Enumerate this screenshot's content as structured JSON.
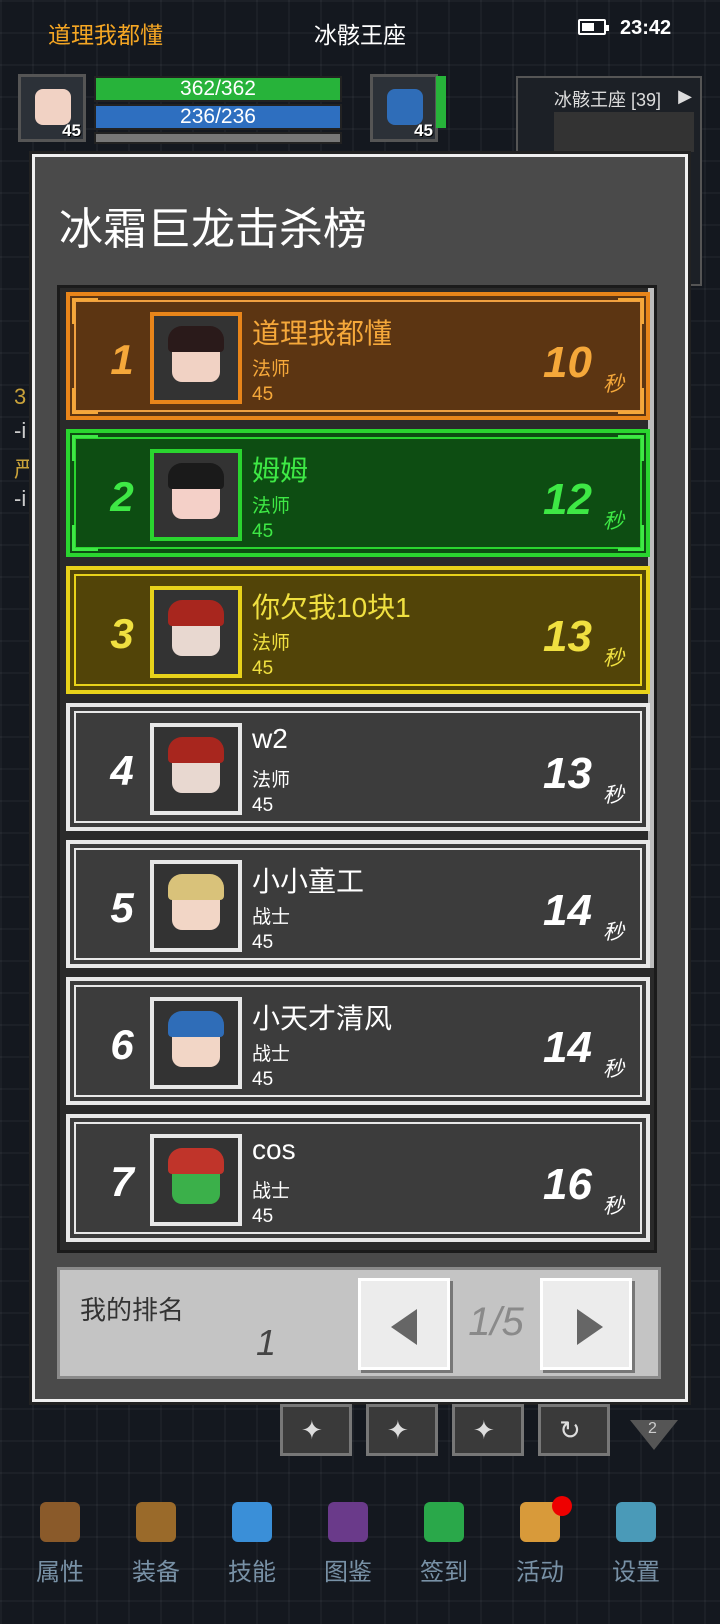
{
  "status_bar": {
    "player_name": "道理我都懂",
    "location": "冰骸王座",
    "time": "23:42"
  },
  "hud": {
    "player_level": "45",
    "hp": "362/362",
    "mp": "236/236",
    "pet_level": "45",
    "minimap_title": "冰骸王座 [39]"
  },
  "background_text": [
    "3",
    "-i",
    "严",
    "-i"
  ],
  "panel": {
    "title": "冰霜巨龙击杀榜",
    "time_unit": "秒",
    "entries": [
      {
        "rank": "1",
        "name": "道理我都懂",
        "class": "法师",
        "level": "45",
        "time": "10",
        "style": "gold",
        "face": "#f1d2c4",
        "hair": "#2a1a1a"
      },
      {
        "rank": "2",
        "name": "姆姆",
        "class": "法师",
        "level": "45",
        "time": "12",
        "style": "green",
        "face": "#f4d0c8",
        "hair": "#1a1a1a"
      },
      {
        "rank": "3",
        "name": "你欠我10块1",
        "class": "法师",
        "level": "45",
        "time": "13",
        "style": "yellow",
        "face": "#e8d8d0",
        "hair": "#a8261e"
      },
      {
        "rank": "4",
        "name": "w2",
        "class": "法师",
        "level": "45",
        "time": "13",
        "style": "plain",
        "face": "#e8d8d0",
        "hair": "#a8261e"
      },
      {
        "rank": "5",
        "name": "小小童工",
        "class": "战士",
        "level": "45",
        "time": "14",
        "style": "plain",
        "face": "#f2d6c6",
        "hair": "#d9c27a"
      },
      {
        "rank": "6",
        "name": "小天才清风",
        "class": "战士",
        "level": "45",
        "time": "14",
        "style": "plain",
        "face": "#f2d6c6",
        "hair": "#2f6db8"
      },
      {
        "rank": "7",
        "name": "cos",
        "class": "战士",
        "level": "45",
        "time": "16",
        "style": "plain",
        "face": "#3bb04a",
        "hair": "#c0342a"
      }
    ],
    "my_rank_label": "我的排名",
    "my_rank_value": "1",
    "page_indicator": "1/5"
  },
  "skills_badge": "2",
  "nav": [
    {
      "label": "属性",
      "color": "#8a5a2a"
    },
    {
      "label": "装备",
      "color": "#9a6a2a"
    },
    {
      "label": "技能",
      "color": "#3a8fd8"
    },
    {
      "label": "图鉴",
      "color": "#6a3a8a"
    },
    {
      "label": "签到",
      "color": "#2aa84a"
    },
    {
      "label": "活动",
      "color": "#d89a3a"
    },
    {
      "label": "设置",
      "color": "#4a9ab8"
    }
  ]
}
